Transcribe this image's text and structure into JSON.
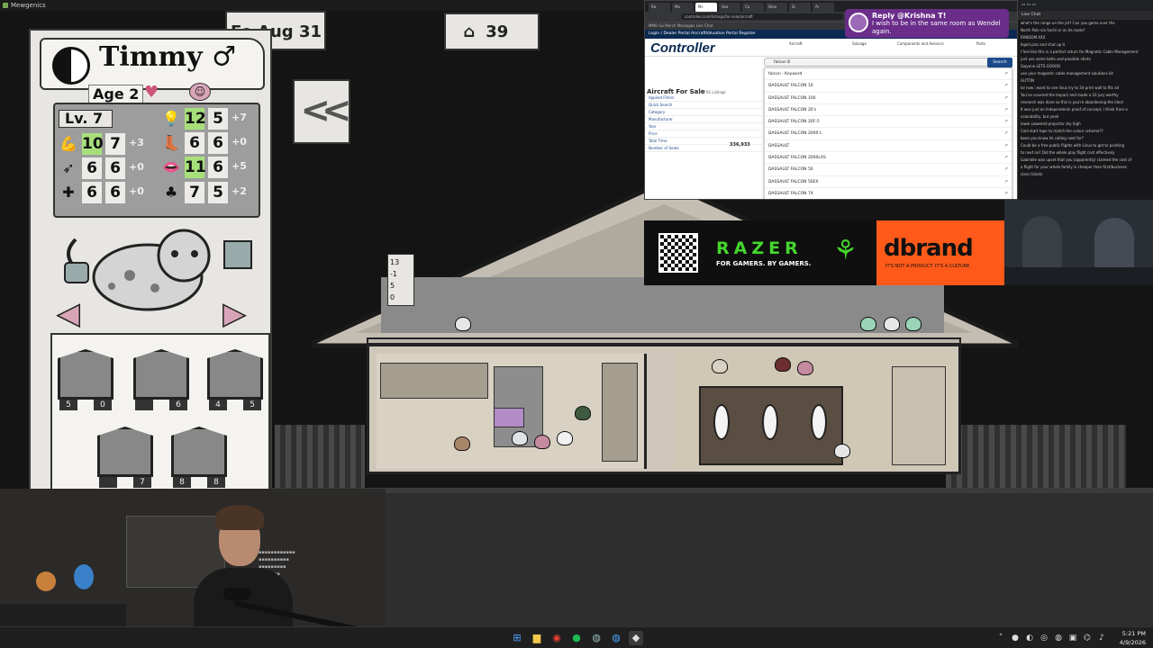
{
  "window": {
    "title": "Mewgenics"
  },
  "hud": {
    "date": "Fe Aug 31",
    "house_cat_count": "39",
    "room_stats": [
      "13",
      "-1",
      "5",
      "0"
    ]
  },
  "cat": {
    "name": "Timmy ♂",
    "age": "Age 2",
    "level": "Lv. 7",
    "stats": [
      {
        "icon": "strength-icon",
        "glyph": "💪",
        "base": "10",
        "total": "7",
        "mod": "+3",
        "highlight": true
      },
      {
        "icon": "dexterity-icon",
        "glyph": "➶",
        "base": "6",
        "total": "6",
        "mod": "+0",
        "highlight": false
      },
      {
        "icon": "constitution-icon",
        "glyph": "✚",
        "base": "6",
        "total": "6",
        "mod": "+0",
        "highlight": false
      },
      {
        "icon": "intelligence-icon",
        "glyph": "💡",
        "base": "12",
        "total": "5",
        "mod": "+7",
        "highlight": true
      },
      {
        "icon": "speed-icon",
        "glyph": "👢",
        "base": "6",
        "total": "6",
        "mod": "+0",
        "highlight": false
      },
      {
        "icon": "charisma-icon",
        "glyph": "👄",
        "base": "11",
        "total": "6",
        "mod": "+5",
        "highlight": true
      },
      {
        "icon": "luck-icon",
        "glyph": "♣",
        "base": "7",
        "total": "5",
        "mod": "+2",
        "highlight": false
      }
    ],
    "abilities": [
      {
        "badge_a": "5",
        "badge_b": "0"
      },
      {
        "badge_a": "",
        "badge_b": "6"
      },
      {
        "badge_a": "4",
        "badge_b": "5"
      },
      {
        "badge_a": "",
        "badge_b": "7"
      },
      {
        "badge_a": "8",
        "badge_b": "8"
      }
    ]
  },
  "browser": {
    "tabs": [
      "Ra",
      "Ma",
      "Mc",
      "Sea",
      "Co",
      "Stea",
      "Sl",
      "Ai"
    ],
    "url": "controller.com/listings/for-sale/aircraft",
    "bookmarks": "MMO Gu   Merch Messages   Live Chat",
    "site_nav": "Login / Dealer Portal   AircraftValuation Portal   Register",
    "logo": "Controller",
    "category_tabs": [
      "Aircraft",
      "Salvage",
      "Components and Avionics",
      "Parts"
    ],
    "search_value": "falcon 8",
    "search_button": "Search",
    "suggestions": [
      "falcon - Keyword",
      "DASSAULT FALCON 10",
      "DASSAULT FALCON 100",
      "DASSAULT FALCON 20's",
      "DASSAULT FALCON 20F-5",
      "DASSAULT FALCON 2000's",
      "DASSAULT",
      "DASSAULT FALCON 2000LXS",
      "DASSAULT FALCON 50",
      "DASSAULT FALCON 50EX",
      "DASSAULT FALCON 7X"
    ],
    "page_title": "Aircraft For Sale",
    "results_count": "1 - 33 of 91 Listings",
    "filters_title": "Applied Filters",
    "filter_rows": [
      "Quick Search",
      "Category",
      "Manufacturer",
      "Year",
      "Price",
      "Total Time",
      "Number of Seats"
    ],
    "price_snippet": "336,933"
  },
  "notification": {
    "title": "Reply @Krishna T!",
    "body": "I wish to be in the same room as Wendel again."
  },
  "sponsor": {
    "razer": "RAZER",
    "razer_tag": "FOR GAMERS. BY GAMERS.",
    "dbrand": "dbrand",
    "dbrand_tag": "IT'S NOT A PRODUCT. IT'S A CULTURE."
  },
  "chat": {
    "title": "Live Chat",
    "messages": [
      "what's the range on the jet? Can you game over the",
      "North Pole via Sochi or on its route?",
      "RANDOM XXX",
      "liquid piss and shut up it",
      "I feel like this is a perfect return for Magnetic Cable Management",
      "just use some bolts and possible sticks",
      "Gwynne LETS GOOOO",
      "use your magnetic cable management solutions kit",
      "GUTTIN",
      "lol now i want to see linus try to 3d print wall to fits all",
      "You've covered the Impact and made a 10 jury worthy",
      "research was done so this is you're abandoning the idea!",
      "It was just an Independents proof of concept, I think from a",
      "colorability, but yeah",
      "lower powered projector sky high",
      "Cold start tape to match the colour scheme??",
      "been you know its calling next for?",
      "Could be a free public flights with Linus to get to pointing",
      "to next no? Did the whole play flight cost effectively",
      "Gabrielle was upset that you (apparently) claimed the cost of",
      "a flight for your whole family is cheaper than first/business",
      "class tickets"
    ]
  },
  "taskbar": {
    "time": "5:21 PM",
    "date": "4/9/2026"
  }
}
